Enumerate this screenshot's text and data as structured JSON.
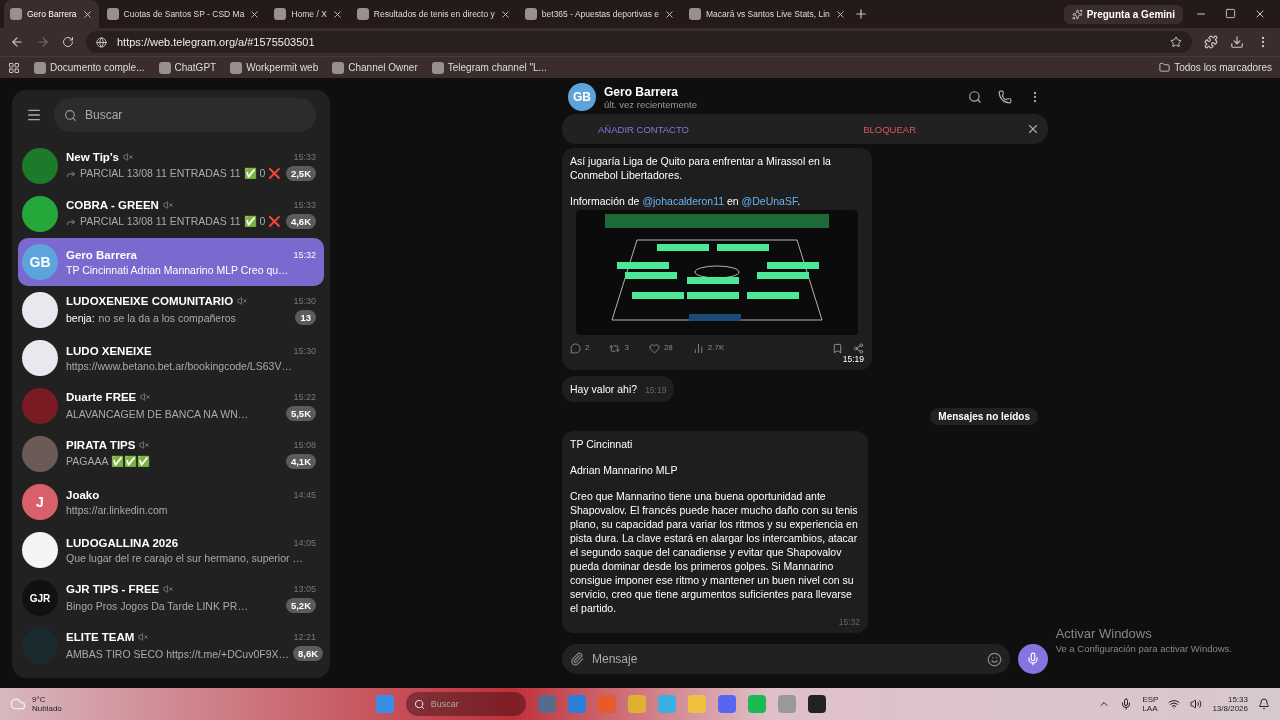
{
  "browser": {
    "tabs": [
      {
        "title": "Gero Barrera",
        "selected": true
      },
      {
        "title": "Cuotas de Santos SP - CSD Ma",
        "selected": false
      },
      {
        "title": "Home / X",
        "selected": false
      },
      {
        "title": "Resultados de tenis en directo y",
        "selected": false
      },
      {
        "title": "bet365 - Apuestas deportivas e",
        "selected": false
      },
      {
        "title": "Macará vs Santos Live Stats, Lin",
        "selected": false
      }
    ],
    "gemini": "Pregunta a Gemini",
    "url": "https://web.telegram.org/a/#1575503501",
    "bookmarks": [
      "Documento comple...",
      "ChatGPT",
      "Workpermit web",
      "Channel Owner",
      "Telegram channel \"L..."
    ],
    "all_bookmarks": "Todos los marcadores"
  },
  "sidebar": {
    "search": {
      "placeholder": "Buscar"
    },
    "chats": [
      {
        "name": "New Tip's",
        "muted": true,
        "time": "15:33",
        "forwarded": true,
        "preview": "PARCIAL 13/08 11 ENTRADAS 11 ✅ 0 ❌",
        "badge": "2,5K",
        "selected": false,
        "avatar": {
          "kind": "image",
          "color": "#1d7a2a"
        }
      },
      {
        "name": "COBRA - GREEN",
        "muted": true,
        "time": "15:33",
        "forwarded": true,
        "preview": "PARCIAL 13/08 11 ENTRADAS 11 ✅ 0 ❌",
        "badge": "4,6K",
        "selected": false,
        "avatar": {
          "kind": "image",
          "color": "#25a83a"
        }
      },
      {
        "name": "Gero Barrera",
        "muted": false,
        "time": "15:32",
        "forwarded": false,
        "preview": "TP Cincinnati  Adrian Mannarino MLP Creo qu…",
        "selected": true,
        "avatar": {
          "kind": "initials",
          "initials": "GB",
          "color": "#5ea4dc"
        }
      },
      {
        "name": "LUDOXENEIXE COMUNITARIO",
        "muted": true,
        "time": "15:30",
        "forwarded": false,
        "sender": "benja:",
        "preview": "no se la da a los compañeros",
        "badge": "13",
        "selected": false,
        "avatar": {
          "kind": "image",
          "color": "#e8e8ee"
        }
      },
      {
        "name": "LUDO XENEIXE",
        "muted": false,
        "time": "15:30",
        "forwarded": false,
        "preview": "https://www.betano.bet.ar/bookingcode/LS63V…",
        "selected": false,
        "avatar": {
          "kind": "image",
          "color": "#e8e8ee"
        }
      },
      {
        "name": "Duarte FREE",
        "muted": true,
        "time": "15:22",
        "forwarded": false,
        "preview": "ALAVANCAGEM DE BANCA NA WN…",
        "badge": "5,5K",
        "selected": false,
        "avatar": {
          "kind": "image",
          "color": "#7a1a22"
        }
      },
      {
        "name": "PIRATA TIPS",
        "muted": true,
        "time": "15:08",
        "forwarded": false,
        "preview": "PAGAAA ✅✅✅",
        "badge": "4,1K",
        "selected": false,
        "avatar": {
          "kind": "image",
          "color": "#6b5a55"
        }
      },
      {
        "name": "Joako",
        "muted": false,
        "time": "14:45",
        "forwarded": false,
        "preview": "https://ar.linkedin.com",
        "selected": false,
        "avatar": {
          "kind": "initials",
          "initials": "J",
          "color": "#d9606a"
        }
      },
      {
        "name": "LUDOGALLINA 2026",
        "muted": false,
        "time": "14:05",
        "forwarded": false,
        "preview": "Que lugar del re carajo el sur hermano, superior …",
        "selected": false,
        "avatar": {
          "kind": "image",
          "color": "#f4f4f4"
        }
      },
      {
        "name": "GJR TIPS - FREE",
        "muted": true,
        "time": "13:05",
        "forwarded": false,
        "preview": "Bingo Pros Jogos Da Tarde  LINK PR…",
        "badge": "5,2K",
        "selected": false,
        "avatar": {
          "kind": "initials",
          "initials": "GJR",
          "color": "#111111"
        }
      },
      {
        "name": "ELITE TEAM",
        "muted": true,
        "time": "12:21",
        "forwarded": false,
        "preview": "AMBAS TIRO SECO https://t.me/+DCuv0F9X…",
        "badge": "8,6K",
        "selected": false,
        "avatar": {
          "kind": "image",
          "color": "#1b2a2e"
        }
      }
    ]
  },
  "chat": {
    "name": "Gero Barrera",
    "initials": "GB",
    "status": "últ. vez recientemente",
    "actions": [
      {
        "label": "AÑADIR CONTACTO",
        "kind": "add"
      },
      {
        "label": "BLOQUEAR",
        "kind": "block"
      }
    ],
    "messages": [
      {
        "kind": "post",
        "paragraphs": [
          [
            {
              "text": "Así jugaría Liga de Quito para enfrentar a Mirassol en la Conmebol Libertadores."
            }
          ],
          [
            {
              "text": "Información de "
            },
            {
              "text": "@johacalderon11",
              "link": true
            },
            {
              "text": " en "
            },
            {
              "text": "@DeUnaSF",
              "link": true
            },
            {
              "text": "."
            }
          ]
        ],
        "stats": [
          {
            "kind": "reply",
            "value": "2"
          },
          {
            "kind": "repost",
            "value": "3"
          },
          {
            "kind": "like",
            "value": "28"
          },
          {
            "kind": "views",
            "value": "2.7K"
          }
        ],
        "time": "15:19"
      },
      {
        "kind": "text",
        "paragraphs": [
          [
            {
              "text": "Hay valor ahi?"
            }
          ]
        ],
        "time": "15:19"
      },
      {
        "kind": "divider",
        "text": "Mensajes no leídos"
      },
      {
        "kind": "text",
        "paragraphs": [
          [
            {
              "text": "TP Cincinnati"
            }
          ],
          [
            {
              "text": "Adrian Mannarino MLP"
            }
          ],
          [
            {
              "text": "Creo que Mannarino tiene una buena oportunidad ante Shapovalov. El francés puede hacer mucho daño con su tenis plano, su capacidad para variar los ritmos y su experiencia en pista dura. La clave estará en alargar los intercambios, atacar el segundo saque del canadiense y evitar que Shapovalov pueda dominar desde los primeros golpes. Si Mannarino consigue imponer ese ritmo y mantener un buen nivel con su servicio, creo que tiene argumentos suficientes para llevarse el partido."
            }
          ]
        ],
        "time": "15:32"
      }
    ],
    "composer": {
      "placeholder": "Mensaje"
    }
  },
  "activation": {
    "title": "Activar Windows",
    "text": "Ve a Configuración para activar Windows."
  },
  "taskbar": {
    "temperature": "9°C",
    "weather": "Nublado",
    "search": {
      "placeholder": "Buscar"
    },
    "language": "ESP",
    "layout": "LAA",
    "time": "15:33",
    "date": "13/8/2026"
  }
}
